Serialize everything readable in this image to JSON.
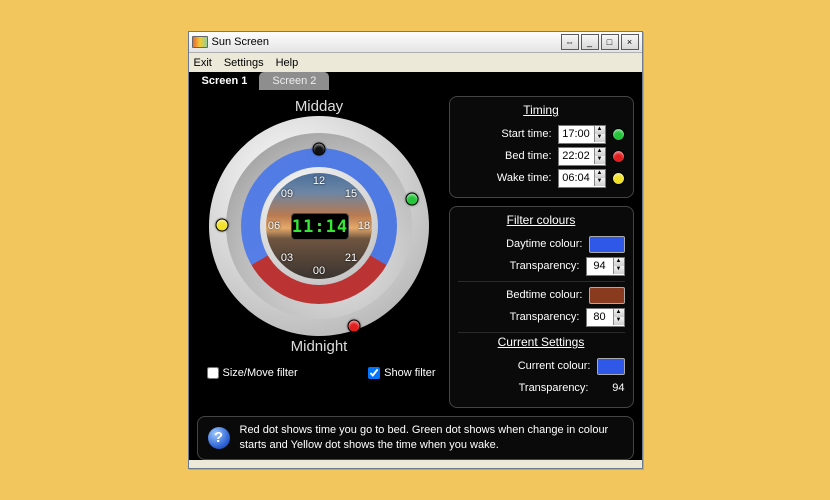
{
  "window": {
    "title": "Sun Screen"
  },
  "menu": {
    "exit": "Exit",
    "settings": "Settings",
    "help": "Help"
  },
  "tabs": {
    "screen1": "Screen 1",
    "screen2": "Screen 2"
  },
  "dial": {
    "top_label": "Midday",
    "bottom_label": "Midnight",
    "hours": [
      "12",
      "15",
      "18",
      "21",
      "00",
      "03",
      "06",
      "09"
    ],
    "clock": "11:14",
    "markers": {
      "start": {
        "color": "#26c43b"
      },
      "bed": {
        "color": "#e21f1f"
      },
      "wake": {
        "color": "#f2e12a"
      },
      "top": {
        "color": "#111"
      }
    }
  },
  "checks": {
    "sizemove": {
      "label": "Size/Move filter",
      "checked": false
    },
    "show": {
      "label": "Show filter",
      "checked": true
    }
  },
  "timing": {
    "heading": "Timing",
    "start_lbl": "Start time:",
    "start_val": "17:00",
    "bed_lbl": "Bed time:",
    "bed_val": "22:02",
    "wake_lbl": "Wake time:",
    "wake_val": "06:04"
  },
  "colours": {
    "heading": "Filter colours",
    "day_lbl": "Daytime colour:",
    "day_hex": "#2f57e8",
    "day_t_lbl": "Transparency:",
    "day_t": "94",
    "bed_lbl": "Bedtime colour:",
    "bed_hex": "#8a3a1f",
    "bed_t_lbl": "Transparency:",
    "bed_t": "80"
  },
  "current": {
    "heading": "Current Settings",
    "colour_lbl": "Current colour:",
    "colour_hex": "#2f57e8",
    "t_lbl": "Transparency:",
    "t_val": "94"
  },
  "info": {
    "text": "Red dot shows time you go to bed. Green dot shows when change in colour starts and Yellow dot shows the time when you wake."
  }
}
